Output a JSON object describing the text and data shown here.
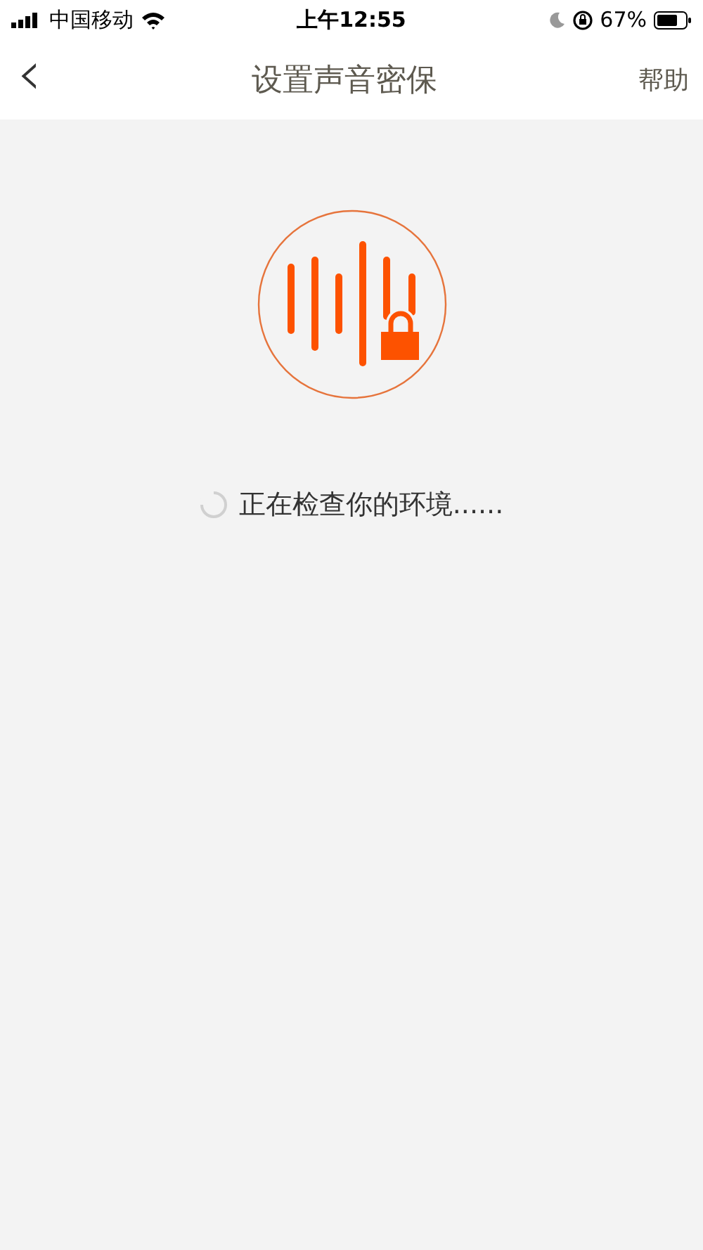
{
  "status_bar": {
    "carrier": "中国移动",
    "time": "上午12:55",
    "battery": "67%"
  },
  "nav_bar": {
    "back": "‹",
    "title": "设置声音密保",
    "action": "帮助"
  },
  "status_message": "正在检查你的环境......"
}
